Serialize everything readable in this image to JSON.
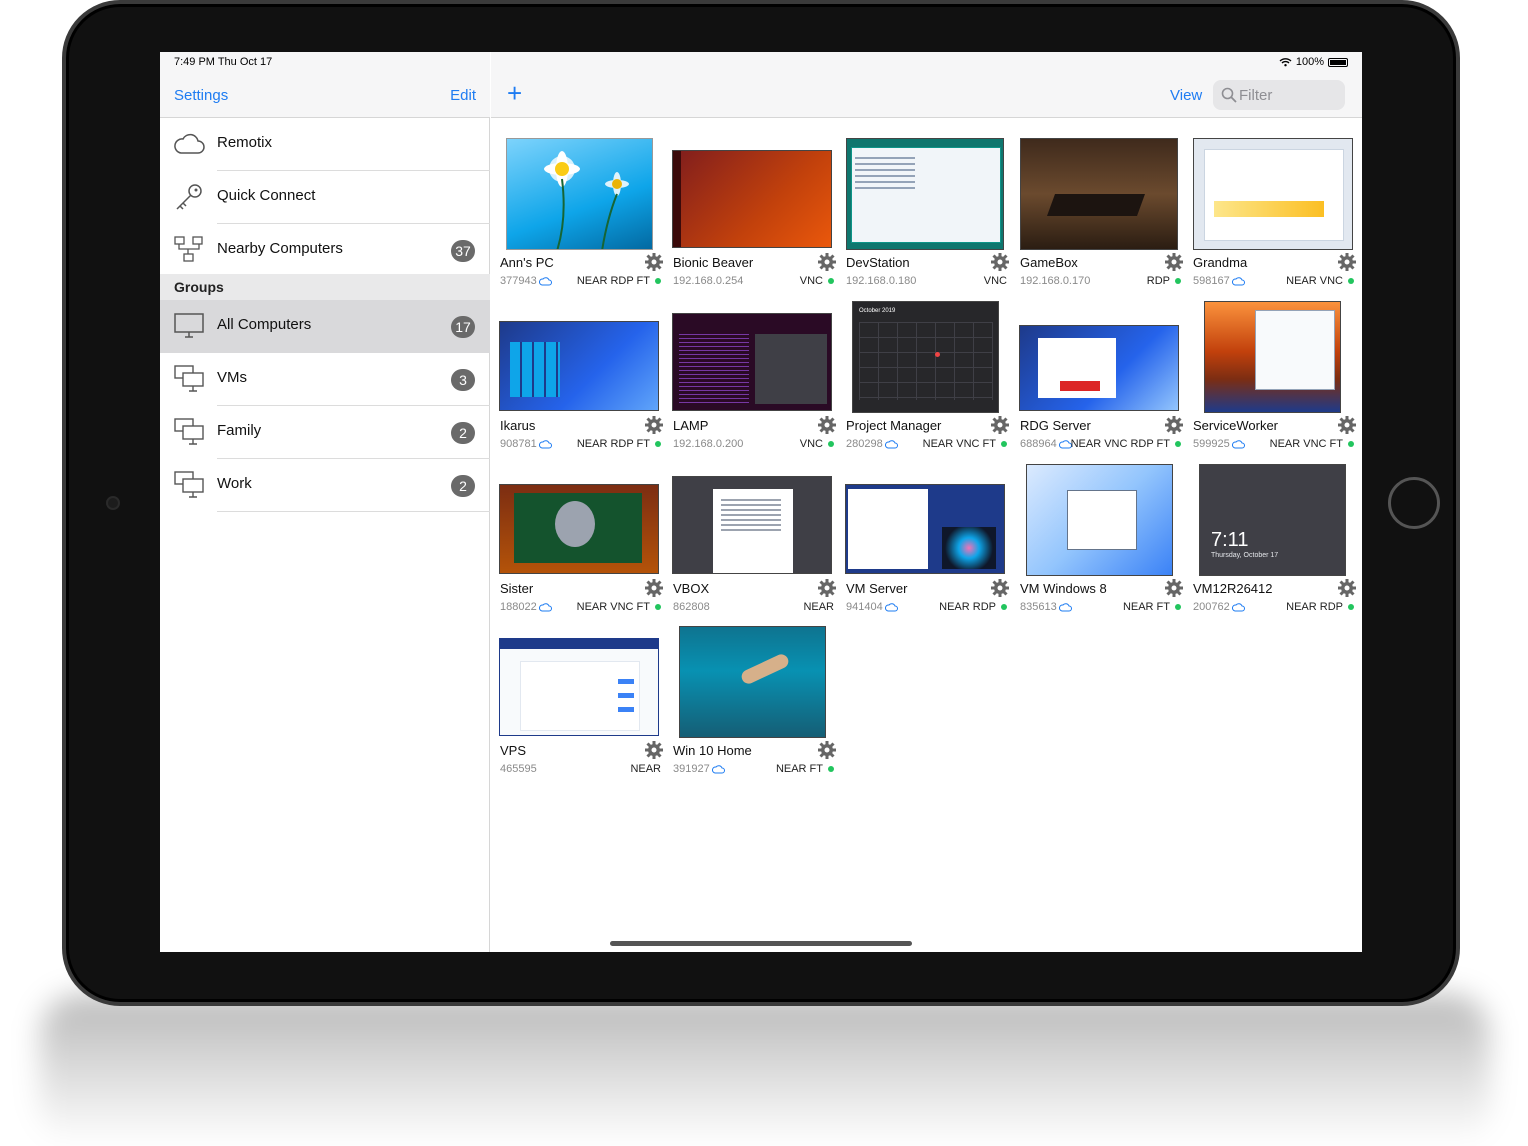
{
  "status": {
    "time": "7:49 PM   Thu Oct 17",
    "battery": "100%"
  },
  "sidebar": {
    "settings_label": "Settings",
    "edit_label": "Edit",
    "items": [
      {
        "label": "Remotix",
        "icon": "cloud-icon",
        "badge": ""
      },
      {
        "label": "Quick Connect",
        "icon": "key-icon",
        "badge": ""
      },
      {
        "label": "Nearby Computers",
        "icon": "network-icon",
        "badge": "37"
      }
    ],
    "groups_title": "Groups",
    "groups": [
      {
        "label": "All Computers",
        "icon": "monitor-icon",
        "badge": "17",
        "selected": true
      },
      {
        "label": "VMs",
        "icon": "monitors-icon",
        "badge": "3"
      },
      {
        "label": "Family",
        "icon": "monitors-icon",
        "badge": "2"
      },
      {
        "label": "Work",
        "icon": "monitors-icon",
        "badge": "2"
      }
    ]
  },
  "toolbar": {
    "add_label": "+",
    "view_label": "View",
    "filter_placeholder": "Filter"
  },
  "computers": [
    {
      "name": "Ann's PC",
      "id": "377943",
      "cloud": true,
      "protocols": "NEAR RDP FT",
      "online": true,
      "thumb": "win8-daisy"
    },
    {
      "name": "Bionic Beaver",
      "id": "192.168.0.254",
      "cloud": false,
      "protocols": "VNC",
      "online": true,
      "thumb": "ubuntu"
    },
    {
      "name": "DevStation",
      "id": "192.168.0.180",
      "cloud": false,
      "protocols": "VNC",
      "online": false,
      "thumb": "arduino"
    },
    {
      "name": "GameBox",
      "id": "192.168.0.170",
      "cloud": false,
      "protocols": "RDP",
      "online": true,
      "thumb": "game"
    },
    {
      "name": "Grandma",
      "id": "598167",
      "cloud": true,
      "protocols": "NEAR VNC",
      "online": true,
      "thumb": "browser"
    },
    {
      "name": "Ikarus",
      "id": "908781",
      "cloud": true,
      "protocols": "NEAR RDP FT",
      "online": true,
      "thumb": "win10-start"
    },
    {
      "name": "LAMP",
      "id": "192.168.0.200",
      "cloud": false,
      "protocols": "VNC",
      "online": true,
      "thumb": "terminal"
    },
    {
      "name": "Project Manager",
      "id": "280298",
      "cloud": true,
      "protocols": "NEAR VNC FT",
      "online": true,
      "thumb": "calendar"
    },
    {
      "name": "RDG Server",
      "id": "688964",
      "cloud": true,
      "protocols": "NEAR VNC RDP FT",
      "online": true,
      "thumb": "win10-app"
    },
    {
      "name": "ServiceWorker",
      "id": "599925",
      "cloud": true,
      "protocols": "NEAR VNC FT",
      "online": true,
      "thumb": "elcapitan"
    },
    {
      "name": "Sister",
      "id": "188022",
      "cloud": true,
      "protocols": "NEAR VNC FT",
      "online": true,
      "thumb": "video"
    },
    {
      "name": "VBOX",
      "id": "862808",
      "cloud": false,
      "protocols": "NEAR",
      "online": false,
      "thumb": "document"
    },
    {
      "name": "VM Server",
      "id": "941404",
      "cloud": true,
      "protocols": "NEAR RDP",
      "online": true,
      "thumb": "server"
    },
    {
      "name": "VM Windows 8",
      "id": "835613",
      "cloud": true,
      "protocols": "NEAR FT",
      "online": true,
      "thumb": "win8-blue"
    },
    {
      "name": "VM12R26412",
      "id": "200762",
      "cloud": true,
      "protocols": "NEAR RDP",
      "online": true,
      "thumb": "lock"
    },
    {
      "name": "VPS",
      "id": "465595",
      "cloud": false,
      "protocols": "NEAR",
      "online": false,
      "thumb": "webpage"
    },
    {
      "name": "Win 10 Home",
      "id": "391927",
      "cloud": true,
      "protocols": "NEAR FT",
      "online": true,
      "thumb": "underwater"
    }
  ],
  "lockscreen": {
    "time": "7:11",
    "date": "Thursday, October 17"
  },
  "calendar": {
    "month": "October 2019"
  },
  "colors": {
    "accent": "#1e7cf2",
    "online": "#22c55e",
    "badge": "#6a6a6a"
  }
}
